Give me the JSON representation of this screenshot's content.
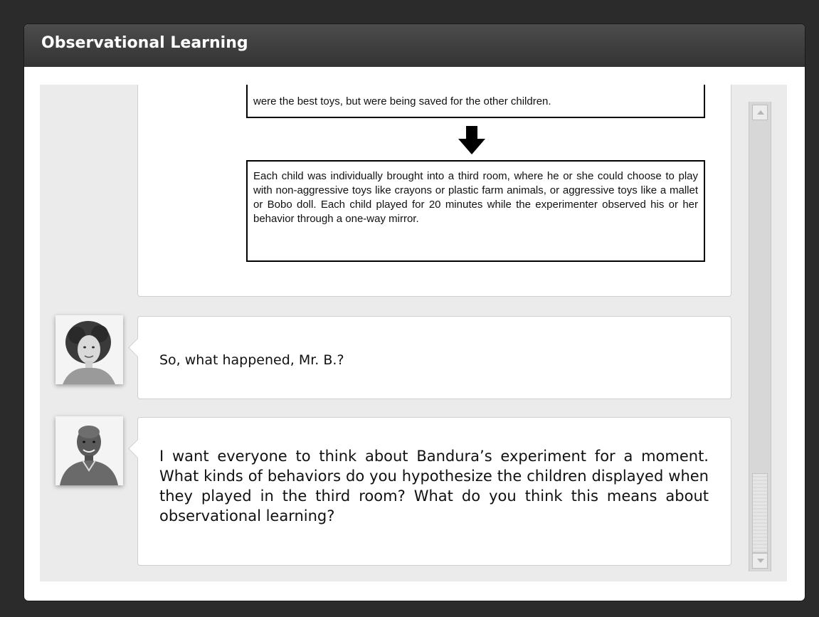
{
  "window": {
    "title": "Observational Learning"
  },
  "diagram": {
    "top_box_text": "were the best toys, but were being saved for the other children.",
    "bottom_box_text": "Each child was individually brought into a third room, where he or she could choose to play with non-aggressive toys like crayons or plastic farm animals, or aggressive toys like a mallet or Bobo doll. Each child played for 20 minutes while the experimenter observed his or her behavior through a one-way mirror.",
    "arrow_icon": "down-arrow-icon"
  },
  "conversation": [
    {
      "speaker_icon": "student-avatar",
      "text": "So, what happened, Mr. B.?"
    },
    {
      "speaker_icon": "teacher-avatar",
      "text": "I want everyone to think about Bandura’s experiment for a moment. What kinds of behaviors do you hypothesize the children displayed when they played in the third room? What do you think this means about observational learning?"
    }
  ],
  "scrollbar": {
    "position_fraction": 0.85
  },
  "colors": {
    "background": "#2b2b2b",
    "titlebar": "#3d3d3d",
    "content_bg": "#ebebeb"
  }
}
